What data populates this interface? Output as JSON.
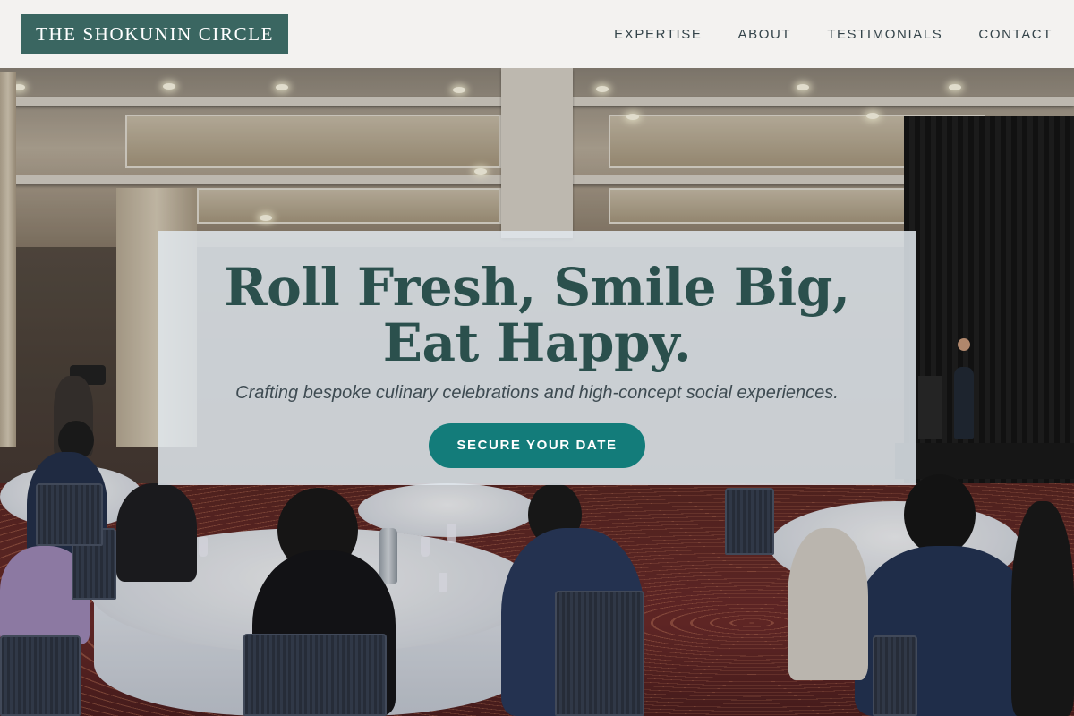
{
  "header": {
    "brand": "THE SHOKUNIN CIRCLE",
    "nav": [
      {
        "label": "EXPERTISE"
      },
      {
        "label": "ABOUT"
      },
      {
        "label": "TESTIMONIALS"
      },
      {
        "label": "CONTACT"
      }
    ]
  },
  "hero": {
    "title": "Roll Fresh, Smile Big, Eat Happy.",
    "subtitle": "Crafting bespoke culinary celebrations and high-concept social experiences.",
    "cta_label": "SECURE YOUR DATE",
    "background_image": "banquet-hall-event-photo"
  },
  "colors": {
    "brand_bg": "#3a6661",
    "title_text": "#2b504d",
    "cta_bg": "#137c7a",
    "header_bg": "#f3f2f0"
  }
}
